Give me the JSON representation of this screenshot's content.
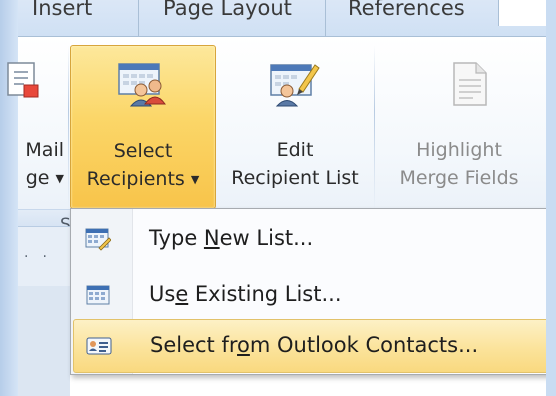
{
  "tabs": [
    {
      "label": "Insert"
    },
    {
      "label": "Page Layout"
    },
    {
      "label": "References",
      "active": true
    }
  ],
  "ribbon": {
    "buttons": [
      {
        "line1": "Mail",
        "line2": "ge",
        "icon": "start-mail-merge-icon"
      },
      {
        "line1": "Select",
        "line2": "Recipients",
        "icon": "select-recipients-icon",
        "pressed": true
      },
      {
        "line1": "Edit",
        "line2": "Recipient List",
        "icon": "edit-recipient-list-icon"
      },
      {
        "line1": "Highlight",
        "line2": "Merge Fields",
        "icon": "highlight-merge-fields-icon",
        "disabled": true
      }
    ],
    "group_label_fragment": "S"
  },
  "menu": {
    "items": [
      {
        "pre": "Type ",
        "mnemonic": "N",
        "post": "ew List...",
        "icon": "type-new-list-icon"
      },
      {
        "pre": "Us",
        "mnemonic": "e",
        "post": " Existing List...",
        "icon": "existing-list-icon"
      },
      {
        "pre": "Select fr",
        "mnemonic": "o",
        "post": "m Outlook Contacts...",
        "icon": "outlook-contacts-icon",
        "highlighted": true
      }
    ]
  },
  "colors": {
    "pressed_gradient_top": "#fde89b",
    "pressed_gradient_bottom": "#f8c44a",
    "frame": "#c9dcf2"
  }
}
